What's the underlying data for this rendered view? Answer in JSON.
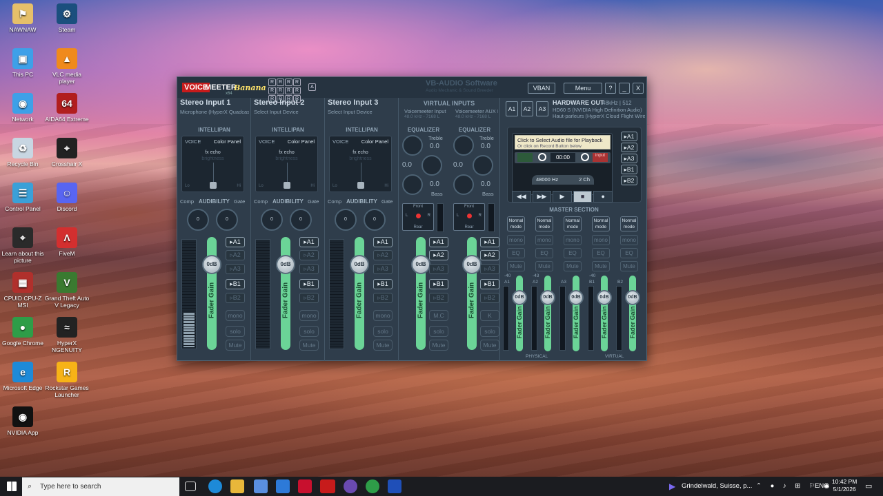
{
  "desktop": {
    "icons": [
      {
        "label": "NAWNAW",
        "name": "user-folder-icon",
        "color": "#e6c06a",
        "glyph": "⚑"
      },
      {
        "label": "Steam",
        "name": "steam-icon",
        "color": "#1b4f7e",
        "glyph": "⚙"
      },
      {
        "label": "This PC",
        "name": "this-pc-icon",
        "color": "#3ea0e8",
        "glyph": "▣"
      },
      {
        "label": "VLC media player",
        "name": "vlc-icon",
        "color": "#f08a1c",
        "glyph": "▲"
      },
      {
        "label": "Network",
        "name": "network-icon",
        "color": "#3ea0e8",
        "glyph": "◉"
      },
      {
        "label": "AIDA64 Extreme",
        "name": "aida64-icon",
        "color": "#b11e1e",
        "glyph": "64"
      },
      {
        "label": "Recycle Bin",
        "name": "recycle-bin-icon",
        "color": "#c8d6e2",
        "glyph": "♻"
      },
      {
        "label": "Crosshair X",
        "name": "crosshair-x-icon",
        "color": "#222",
        "glyph": "⌖"
      },
      {
        "label": "Control Panel",
        "name": "control-panel-icon",
        "color": "#3aa0d8",
        "glyph": "☰"
      },
      {
        "label": "Discord",
        "name": "discord-icon",
        "color": "#5865f2",
        "glyph": "☺"
      },
      {
        "label": "Learn about this picture",
        "name": "learn-picture-icon",
        "color": "#2a2a2a",
        "glyph": "⌖"
      },
      {
        "label": "FiveM",
        "name": "fivem-icon",
        "color": "#d32f2f",
        "glyph": "Λ"
      },
      {
        "label": "CPUID CPU-Z MSI",
        "name": "cpuz-icon",
        "color": "#b0302c",
        "glyph": "▦"
      },
      {
        "label": "Grand Theft Auto V Legacy",
        "name": "gta-icon",
        "color": "#3a7a30",
        "glyph": "V"
      },
      {
        "label": "Google Chrome",
        "name": "chrome-icon",
        "color": "#2e9d48",
        "glyph": "●"
      },
      {
        "label": "HyperX NGENUITY",
        "name": "hyperx-icon",
        "color": "#222",
        "glyph": "≈"
      },
      {
        "label": "Microsoft Edge",
        "name": "edge-icon",
        "color": "#1d8ad8",
        "glyph": "e"
      },
      {
        "label": "Rockstar Games Launcher",
        "name": "rockstar-icon",
        "color": "#f7b317",
        "glyph": "R"
      },
      {
        "label": "NVIDIA App",
        "name": "nvidia-icon",
        "color": "#111",
        "glyph": "◉"
      }
    ]
  },
  "vm": {
    "logo_voice": "VOICE",
    "logo_meeter": "MEETER",
    "logo_banana": "Banana",
    "logo_x64": "x64",
    "r_buttons": [
      "R",
      "R",
      "R",
      "R",
      "R",
      "R",
      "R",
      "R",
      "R",
      "R",
      "R",
      "R"
    ],
    "a_button": "A",
    "brand": "VB-AUDIO Software",
    "brand_sub": "Audio Mechanic & Sound Breeder",
    "vban": "VBAN",
    "menu": "Menu",
    "help": "?",
    "minimize": "_",
    "close": "X",
    "strips": [
      {
        "title": "Stereo Input 1",
        "device": "Microphone (HyperX Quadcast"
      },
      {
        "title": "Stereo Input 2",
        "device": "Select Input Device"
      },
      {
        "title": "Stereo Input 3",
        "device": "Select Input Device"
      }
    ],
    "intellipan": "INTELLIPAN",
    "voice": "VOICE",
    "color_panel": "Color Panel",
    "fx_echo": "fx echo",
    "brightness": "brightness",
    "lo": "Lo",
    "hi": "Hi",
    "comp": "Comp",
    "audibility": "AUDIBILITY",
    "gate": "Gate",
    "knob_zero": "0",
    "virtual_inputs": "VIRTUAL INPUTS",
    "virtual": [
      {
        "name": "Voicemeeter Input",
        "rate": "48.0 kHz - 7168 L"
      },
      {
        "name": "Voicemeeter AUX I",
        "rate": "48.0 kHz - 7168 L"
      }
    ],
    "equalizer": "EQUALIZER",
    "treble": "Treble",
    "bass": "Bass",
    "eq_val": "0.0",
    "front": "Front",
    "rear": "Rear",
    "L": "L",
    "R": "R",
    "gain": "0dB",
    "fader_gain": "Fader Gain",
    "bus": [
      "A1",
      "A2",
      "A3",
      "B1",
      "B2"
    ],
    "bus_active": {
      "A1": true,
      "A2": false,
      "A3": false,
      "B1": true,
      "B2": false
    },
    "vbus_active": {
      "A1": true,
      "A2": true,
      "A3": false,
      "B1": true,
      "B2": false
    },
    "mono": "mono",
    "solo": "solo",
    "mute": "Mute",
    "mc": "M.C",
    "k": "K",
    "hw_buttons": [
      "A1",
      "A2",
      "A3"
    ],
    "hw_out": "HARDWARE OUT",
    "hw_rate": "48kHz | 512",
    "hw_dev1": "HD60 S (NVIDIA High Definition Audio)",
    "hw_dev2": "Haut-parleurs (HyperX Cloud Flight Wirele",
    "tape_msg1": "Click to Select Audio file for Playback",
    "tape_msg2": "Or click on Record Button below",
    "tape_time": "00:00",
    "tape_input": "input",
    "tape_rate": "48000 Hz",
    "tape_ch": "2 Ch",
    "tape_buttons": [
      "◀◀",
      "▶▶",
      "▶",
      "■",
      "●"
    ],
    "tape_bus": [
      "A1",
      "A2",
      "A3",
      "B1",
      "B2"
    ],
    "master_section": "MASTER SECTION",
    "normal_mode": "Normal mode",
    "eq": "EQ",
    "master_tags": [
      "A1",
      "A2",
      "A3",
      "B1",
      "B2"
    ],
    "master_db": [
      "-40",
      "-43",
      "",
      "-40",
      ""
    ],
    "physical": "PHYSICAL",
    "virtual_label": "VIRTUAL"
  },
  "taskbar": {
    "search_placeholder": "Type here to search",
    "weather": "Grindelwald, Suisse, p...",
    "lang": "ENG",
    "time": "10:42 PM",
    "date": "5/1/2026"
  }
}
